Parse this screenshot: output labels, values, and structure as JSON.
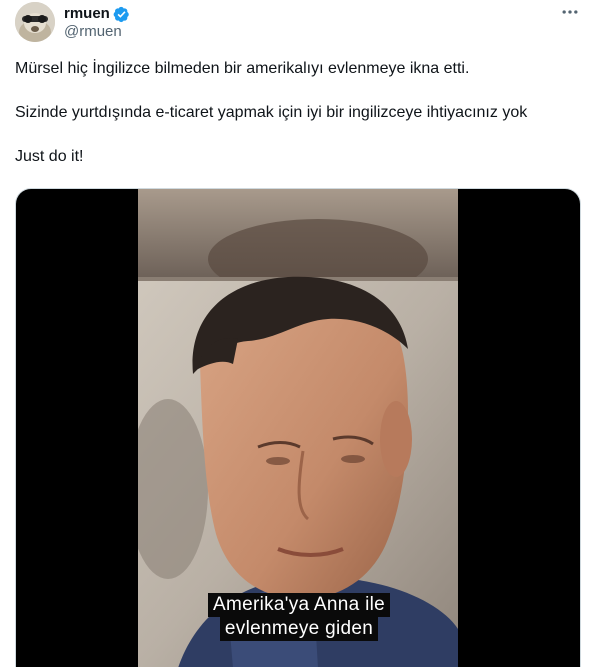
{
  "author": {
    "display_name": "rmuen",
    "handle": "@rmuen",
    "verified_color": "#1d9bf0"
  },
  "icons": {
    "more": "more-horizontal-icon",
    "verified": "verified-badge-icon"
  },
  "tweet": {
    "paragraphs": [
      "Mürsel hiç İngilizce bilmeden bir amerikalıyı evlenmeye ikna etti.",
      "Sizinde yurtdışında e-ticaret yapmak için iyi bir ingilizceye ihtiyacınız yok",
      "Just do it!"
    ]
  },
  "media": {
    "subtitle_lines": [
      "Amerika'ya Anna ile",
      "evlenmeye giden"
    ]
  },
  "colors": {
    "text": "#0f1419",
    "secondary": "#536471",
    "border": "#cfd9de",
    "media_background": "#000000"
  }
}
